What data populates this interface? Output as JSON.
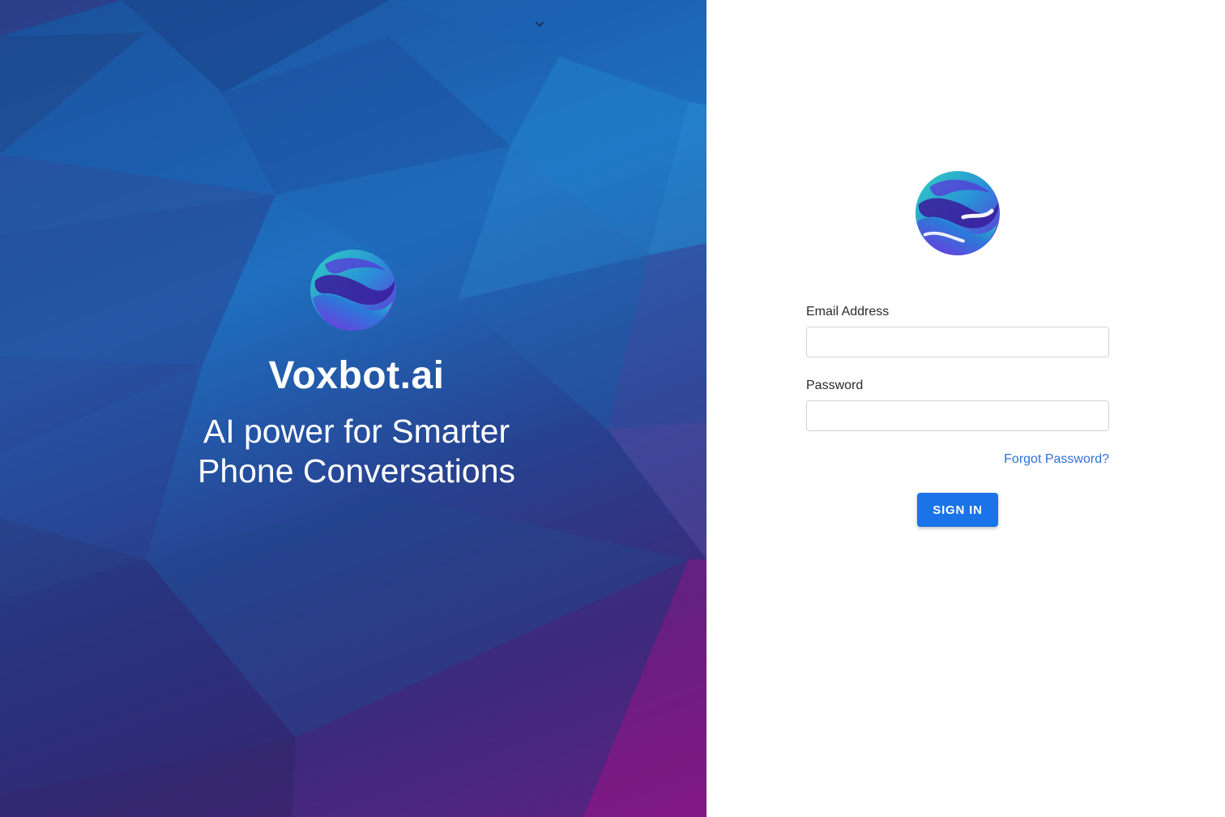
{
  "hero": {
    "brand_name": "Voxbot.ai",
    "tagline_line1": "AI power for Smarter",
    "tagline_line2": "Phone Conversations",
    "chevron_icon": "chevron-down-icon",
    "logo_icon": "voxbot-globe-logo"
  },
  "login": {
    "logo_icon": "voxbot-globe-logo",
    "email_label": "Email Address",
    "email_value": "",
    "password_label": "Password",
    "password_value": "",
    "forgot_password": "Forgot Password?",
    "sign_in": "SIGN IN"
  },
  "colors": {
    "primary": "#1a73e8",
    "link": "#2f6fd6",
    "hero_blue": "#1f6fc0",
    "hero_purple": "#7a1a86"
  }
}
